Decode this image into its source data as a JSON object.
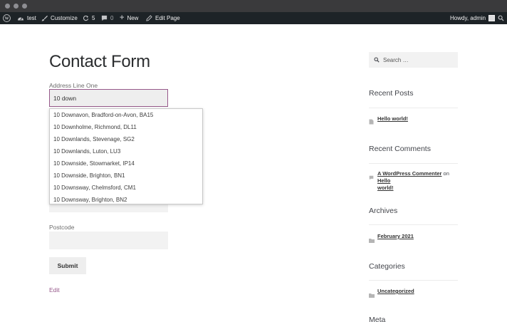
{
  "adminbar": {
    "site_name": "test",
    "customize": "Customize",
    "updates_count": "5",
    "comments_count": "0",
    "new_label": "New",
    "edit_page": "Edit Page",
    "howdy": "Howdy, admin"
  },
  "main": {
    "title": "Contact Form",
    "address_label": "Address Line One",
    "address_value": "10 down",
    "postcode_label": "Postcode",
    "submit_label": "Submit",
    "edit_label": "Edit"
  },
  "suggestions": [
    "10 Downavon, Bradford-on-Avon, BA15",
    "10 Downholme, Richmond, DL11",
    "10 Downlands, Stevenage, SG2",
    "10 Downlands, Luton, LU3",
    "10 Downside, Stowmarket, IP14",
    "10 Downside, Brighton, BN1",
    "10 Downsway, Chelmsford, CM1",
    "10 Downsway, Brighton, BN2"
  ],
  "sidebar": {
    "search_placeholder": "Search …",
    "recent_posts_title": "Recent Posts",
    "recent_post": "Hello world!",
    "recent_comments_title": "Recent Comments",
    "commenter": "A WordPress Commenter",
    "on_word": "on",
    "comment_post_line1": "Hello",
    "comment_post_line2": "world!",
    "archives_title": "Archives",
    "archive_item": "February 2021",
    "categories_title": "Categories",
    "category_item": "Uncategorized",
    "meta_title": "Meta"
  },
  "colors": {
    "accent": "#96588a",
    "adminbar_bg": "#1d2327",
    "field_bg": "#f2f2f2"
  }
}
